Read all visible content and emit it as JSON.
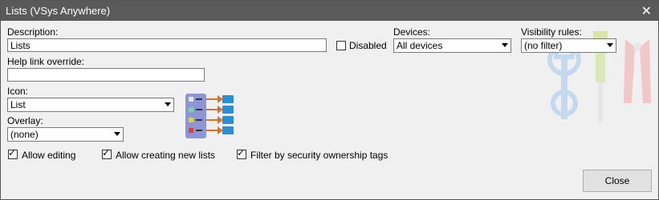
{
  "window": {
    "title": "Lists (VSys Anywhere)"
  },
  "description": {
    "label": "Description:",
    "value": "Lists"
  },
  "disabled": {
    "label": "Disabled",
    "checked": false
  },
  "devices": {
    "label": "Devices:",
    "value": "All devices"
  },
  "visibility": {
    "label": "Visibility rules:",
    "value": "(no filter)"
  },
  "help_link": {
    "label": "Help link override:",
    "value": ""
  },
  "icon": {
    "label": "Icon:",
    "value": "List"
  },
  "overlay": {
    "label": "Overlay:",
    "value": "(none)"
  },
  "options": {
    "allow_editing": {
      "label": "Allow editing",
      "checked": true
    },
    "allow_creating": {
      "label": "Allow creating new lists",
      "checked": true
    },
    "filter_tags": {
      "label": "Filter by security ownership tags",
      "checked": true
    }
  },
  "close_label": "Close",
  "colors": {
    "titlebar": "#5a5a5a",
    "list_icon_bg": "#8c96d6",
    "arrow": "#e07020",
    "folder": "#2b8fd6"
  },
  "icons": {
    "preview": "list-preview-icon",
    "watermark": "tools-watermark-icon"
  }
}
